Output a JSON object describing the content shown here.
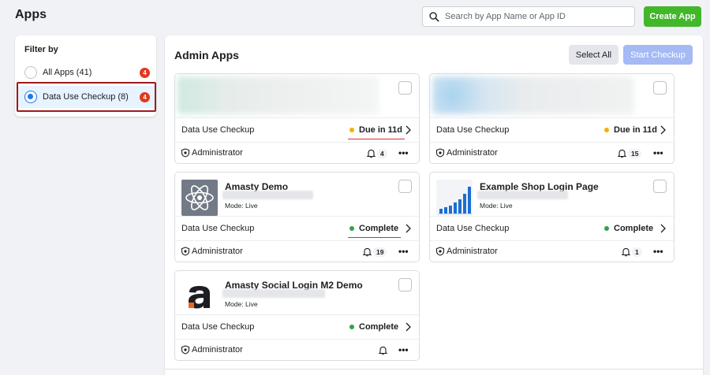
{
  "header": {
    "title": "Apps",
    "search_placeholder": "Search by App Name or App ID",
    "create_label": "Create App"
  },
  "filter": {
    "title": "Filter by",
    "options": [
      {
        "label": "All Apps (41)",
        "badge": "4",
        "selected": false
      },
      {
        "label": "Data Use Checkup (8)",
        "badge": "4",
        "selected": true
      }
    ]
  },
  "admin": {
    "title": "Admin Apps",
    "select_all_label": "Select All",
    "start_checkup_label": "Start Checkup"
  },
  "status_colors": {
    "due": "#f5b000",
    "complete": "#31a24c"
  },
  "cards": [
    {
      "name": "",
      "mode": "",
      "checkup_label": "Data Use Checkup",
      "status": "Due in 11d",
      "role": "Administrator",
      "notifications": "4"
    },
    {
      "name": "",
      "mode": "",
      "checkup_label": "Data Use Checkup",
      "status": "Due in 11d",
      "role": "Administrator",
      "notifications": "15"
    },
    {
      "name": "Amasty Demo",
      "mode": "Mode: Live",
      "checkup_label": "Data Use Checkup",
      "status": "Complete",
      "role": "Administrator",
      "notifications": "19"
    },
    {
      "name": "Example Shop Login Page",
      "mode": "Mode: Live",
      "checkup_label": "Data Use Checkup",
      "status": "Complete",
      "role": "Administrator",
      "notifications": "1"
    },
    {
      "name": "Amasty Social Login M2 Demo",
      "mode": "Mode: Live",
      "checkup_label": "Data Use Checkup",
      "status": "Complete",
      "role": "Administrator",
      "notifications": ""
    }
  ]
}
